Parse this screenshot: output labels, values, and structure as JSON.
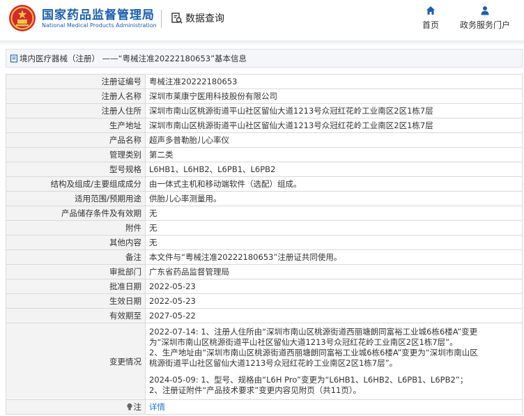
{
  "header": {
    "logo_cn": "国家药品监督管理局",
    "logo_en": "National Medical Products Administration",
    "data_query": "数据查询",
    "nav": {
      "home": "首页",
      "service": "政务服务门户"
    }
  },
  "title": "境内医疗器械（注册） ——“粤械注准20222180653”基本信息",
  "rows": [
    {
      "label": "注册证编号",
      "value": "粤械注准20222180653"
    },
    {
      "label": "注册人名称",
      "value": "深圳市莱康宁医用科技股份有限公司"
    },
    {
      "label": "注册人住所",
      "value": "深圳市南山区桃源街道平山社区留仙大道1213号众冠红花岭工业南区2区1栋7层"
    },
    {
      "label": "生产地址",
      "value": "深圳市南山区桃源街道平山社区留仙大道1213号众冠红花岭工业南区2区1栋7层"
    },
    {
      "label": "产品名称",
      "value": "超声多普勒胎儿心率仪"
    },
    {
      "label": "管理类别",
      "value": "第二类"
    },
    {
      "label": "型号规格",
      "value": "L6HB1、L6HB2、L6PB1、L6PB2"
    },
    {
      "label": "结构及组成/主要组成成分",
      "value": "由一体式主机和移动端软件（选配）组成。"
    },
    {
      "label": "适用范围/预期用途",
      "value": "供胎儿心率测量用。"
    },
    {
      "label": "产品储存条件及有效期",
      "value": "无"
    },
    {
      "label": "附件",
      "value": "无"
    },
    {
      "label": "其他内容",
      "value": "无"
    },
    {
      "label": "备注",
      "value": "本文件与“粤械注准20222180653”注册证共同使用。"
    },
    {
      "label": "审批部门",
      "value": "广东省药品监督管理局"
    },
    {
      "label": "批准日期",
      "value": "2022-05-23"
    },
    {
      "label": "生效日期",
      "value": "2022-05-23"
    },
    {
      "label": "有效期至",
      "value": "2027-05-22"
    }
  ],
  "change": {
    "label": "变更情况",
    "block1": [
      "2022-07-14: 1、注册人住所由“深圳市南山区桃源街道西丽塘朗同富裕工业城6栋6楼A”变更",
      "为“深圳市南山区桃源街道平山社区留仙大道1213号众冠红花岭工业南区2区1栋7层”。",
      "2、生产地址由“深圳市南山区桃源街道西丽塘朗同富裕工业城6栋6楼A”变更为“深圳市南山区",
      "桃源街道平山社区留仙大道1213号众冠红花岭工业南区2区1栋7层”。"
    ],
    "block2": [
      "2024-05-09: 1、型号、规格由“L6H Pro”变更为“L6HB1、L6HB2、L6PB1、L6PB2”；",
      "2、注册证附件“产品技术要求”变更内容见附页（共11页）。"
    ]
  },
  "note": {
    "label": "注",
    "link": "详情"
  }
}
